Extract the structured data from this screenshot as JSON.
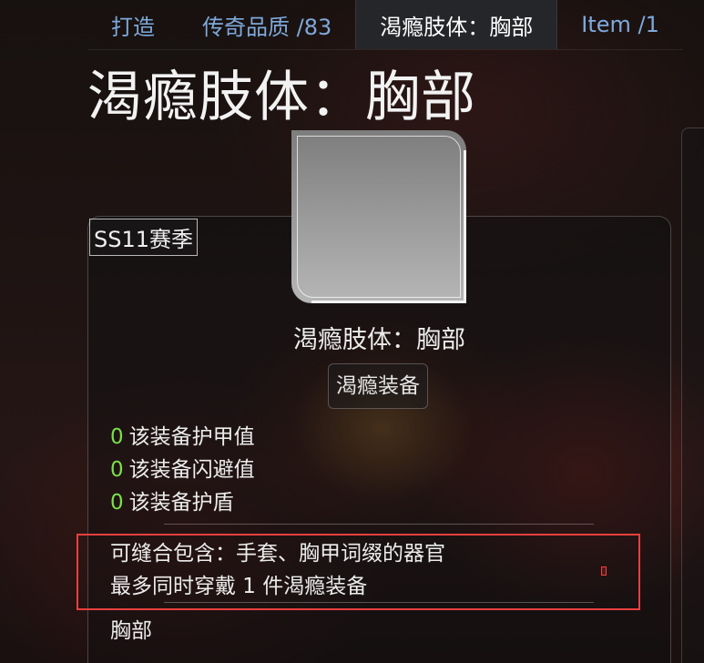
{
  "tabs": [
    {
      "label": "打造",
      "active": false
    },
    {
      "label": "传奇品质 /83",
      "active": false
    },
    {
      "label": "渴瘾肢体：胸部",
      "active": true
    },
    {
      "label": "Item /1",
      "active": false
    }
  ],
  "page_title": "渴瘾肢体：胸部",
  "card": {
    "season": "SS11赛季",
    "item_name": "渴瘾肢体：胸部",
    "item_type": "渴瘾装备",
    "stats": [
      {
        "value": "0",
        "label": "该装备护甲值"
      },
      {
        "value": "0",
        "label": "该装备闪避值"
      },
      {
        "value": "0",
        "label": "该装备护盾"
      }
    ],
    "sockets_text": "可缝合包含：手套、胸甲词缀的器官",
    "limit_text": "最多同时穿戴 1 件渴瘾装备",
    "slot": "胸部"
  },
  "colors": {
    "tab_link": "#7ea9dc",
    "stat_value": "#7be04a",
    "highlight_border": "#e8403f"
  }
}
